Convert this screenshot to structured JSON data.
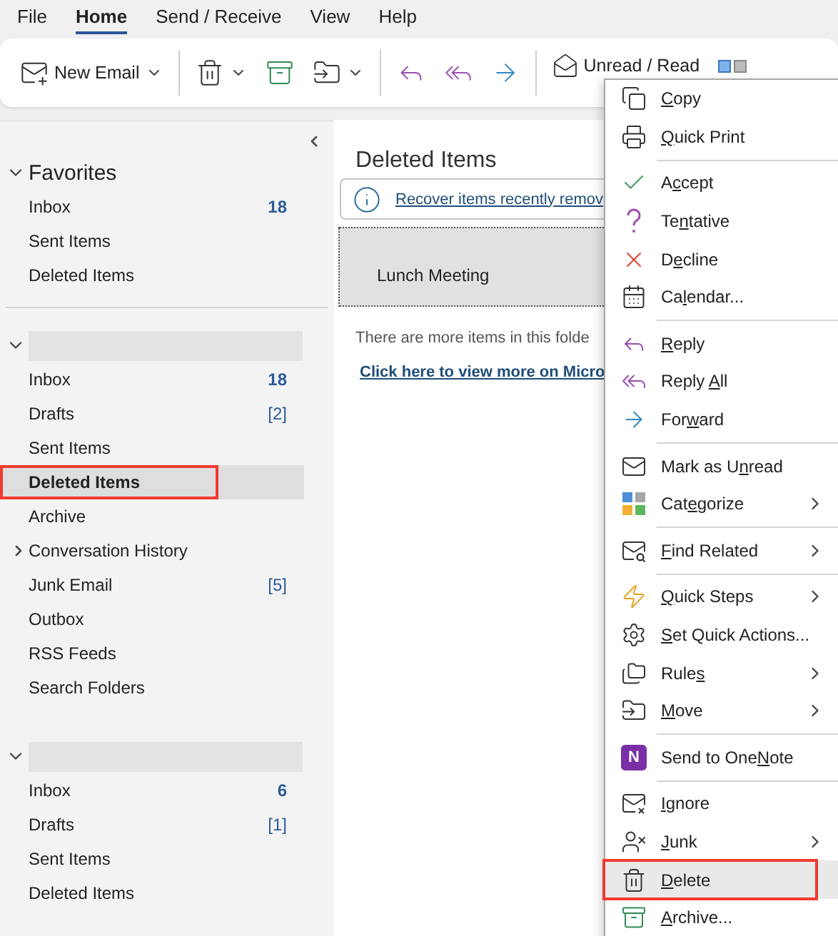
{
  "menu_tabs": [
    {
      "label": "File",
      "selected": false
    },
    {
      "label": "Home",
      "selected": true
    },
    {
      "label": "Send / Receive",
      "selected": false
    },
    {
      "label": "View",
      "selected": false
    },
    {
      "label": "Help",
      "selected": false
    }
  ],
  "ribbon": [
    {
      "kind": "new-email",
      "label": "New Email",
      "dropdown": true
    },
    {
      "kind": "separator"
    },
    {
      "kind": "delete",
      "dropdown": true
    },
    {
      "kind": "archive",
      "dropdown": false
    },
    {
      "kind": "move",
      "dropdown": true
    },
    {
      "kind": "separator"
    },
    {
      "kind": "reply",
      "dropdown": false
    },
    {
      "kind": "reply-all",
      "dropdown": false
    },
    {
      "kind": "forward",
      "dropdown": false
    },
    {
      "kind": "separator"
    },
    {
      "kind": "unread-read",
      "label": "Unread / Read",
      "dropdown": false
    },
    {
      "kind": "categorize",
      "dropdown": false
    }
  ],
  "sidebar": {
    "sections": [
      {
        "kind": "favorites",
        "title": "Favorites",
        "expanded": true,
        "folders": [
          {
            "kind": "unread-count",
            "name": "Inbox",
            "count": "18",
            "selected": false,
            "highlighted": false
          },
          {
            "kind": "plain",
            "name": "Sent Items",
            "selected": false,
            "highlighted": false
          },
          {
            "kind": "plain",
            "name": "Deleted Items",
            "selected": false,
            "highlighted": false
          }
        ]
      },
      {
        "kind": "account",
        "expanded": true,
        "folders": [
          {
            "kind": "unread-count",
            "name": "Inbox",
            "count": "18",
            "selected": false,
            "highlighted": false
          },
          {
            "kind": "total-count",
            "name": "Drafts",
            "count": "[2]",
            "selected": false,
            "highlighted": false
          },
          {
            "kind": "plain",
            "name": "Sent Items",
            "selected": false,
            "highlighted": false
          },
          {
            "kind": "plain",
            "name": "Deleted Items",
            "selected": true,
            "highlighted": true
          },
          {
            "kind": "plain",
            "name": "Archive",
            "selected": false,
            "highlighted": false
          },
          {
            "kind": "plain",
            "name": "Conversation History",
            "expanded": false,
            "selected": false,
            "highlighted": false
          },
          {
            "kind": "total-count",
            "name": "Junk Email",
            "count": "[5]",
            "selected": false,
            "highlighted": false
          },
          {
            "kind": "plain",
            "name": "Outbox",
            "selected": false,
            "highlighted": false
          },
          {
            "kind": "plain",
            "name": "RSS Feeds",
            "selected": false,
            "highlighted": false
          },
          {
            "kind": "plain",
            "name": "Search Folders",
            "selected": false,
            "highlighted": false
          }
        ]
      },
      {
        "kind": "account",
        "expanded": true,
        "folders": [
          {
            "kind": "unread-count",
            "name": "Inbox",
            "count": "6",
            "selected": false,
            "highlighted": false
          },
          {
            "kind": "total-count",
            "name": "Drafts",
            "count": "[1]",
            "selected": false,
            "highlighted": false
          },
          {
            "kind": "plain",
            "name": "Sent Items",
            "selected": false,
            "highlighted": false
          },
          {
            "kind": "plain",
            "name": "Deleted Items",
            "selected": false,
            "highlighted": false
          }
        ]
      }
    ]
  },
  "content": {
    "title": "Deleted Items",
    "info_link": "Recover items recently remov",
    "messages": [
      {
        "subject": "Lunch Meeting",
        "selected": true
      }
    ],
    "more_text": "There are more items in this folde",
    "more_link": "Click here to view more on Micro"
  },
  "context_menu": [
    {
      "kind": "copy",
      "key": "C",
      "post": "opy",
      "submenu": false,
      "highlighted": false
    },
    {
      "kind": "quick-print",
      "key": "Q",
      "post": "uick Print",
      "submenu": false,
      "highlighted": false
    },
    {
      "kind": "separator"
    },
    {
      "kind": "accept",
      "pre": "A",
      "key": "c",
      "post": "cept",
      "submenu": false,
      "highlighted": false
    },
    {
      "kind": "tentative",
      "pre": "Te",
      "key": "n",
      "post": "tative",
      "submenu": false,
      "highlighted": false
    },
    {
      "kind": "decline",
      "pre": "D",
      "key": "e",
      "post": "cline",
      "submenu": false,
      "highlighted": false
    },
    {
      "kind": "calendar",
      "pre": "Ca",
      "key": "l",
      "post": "endar...",
      "submenu": false,
      "highlighted": false
    },
    {
      "kind": "separator"
    },
    {
      "kind": "reply",
      "key": "R",
      "post": "eply",
      "submenu": false,
      "highlighted": false
    },
    {
      "kind": "reply-all",
      "pre": "Reply ",
      "key": "A",
      "post": "ll",
      "submenu": false,
      "highlighted": false
    },
    {
      "kind": "forward",
      "pre": "For",
      "key": "w",
      "post": "ard",
      "submenu": false,
      "highlighted": false
    },
    {
      "kind": "separator"
    },
    {
      "kind": "mail",
      "pre": "Mark as U",
      "key": "n",
      "post": "read",
      "submenu": false,
      "highlighted": false
    },
    {
      "kind": "categorize",
      "pre": "Cat",
      "key": "e",
      "post": "gorize",
      "submenu": true,
      "highlighted": false
    },
    {
      "kind": "separator"
    },
    {
      "kind": "find-related",
      "key": "F",
      "post": "ind Related",
      "submenu": true,
      "highlighted": false
    },
    {
      "kind": "separator"
    },
    {
      "kind": "quick-steps",
      "key": "Q",
      "post": "uick Steps",
      "submenu": true,
      "highlighted": false
    },
    {
      "kind": "settings",
      "key": "S",
      "post": "et Quick Actions...",
      "submenu": false,
      "highlighted": false
    },
    {
      "kind": "rules",
      "pre": "Rule",
      "key": "s",
      "submenu": true,
      "highlighted": false
    },
    {
      "kind": "move",
      "key": "M",
      "post": "ove",
      "submenu": true,
      "highlighted": false
    },
    {
      "kind": "separator"
    },
    {
      "kind": "onenote",
      "logo": "N",
      "pre": "Send to One",
      "key": "N",
      "post": "ote",
      "submenu": false,
      "highlighted": false
    },
    {
      "kind": "separator"
    },
    {
      "kind": "ignore",
      "key": "I",
      "post": "gnore",
      "submenu": false,
      "highlighted": false
    },
    {
      "kind": "junk",
      "key": "J",
      "post": "unk",
      "submenu": true,
      "highlighted": false
    },
    {
      "kind": "delete",
      "key": "D",
      "post": "elete",
      "submenu": false,
      "highlighted": true
    },
    {
      "kind": "archive",
      "key": "A",
      "post": "rchive...",
      "submenu": false,
      "highlighted": false
    }
  ]
}
